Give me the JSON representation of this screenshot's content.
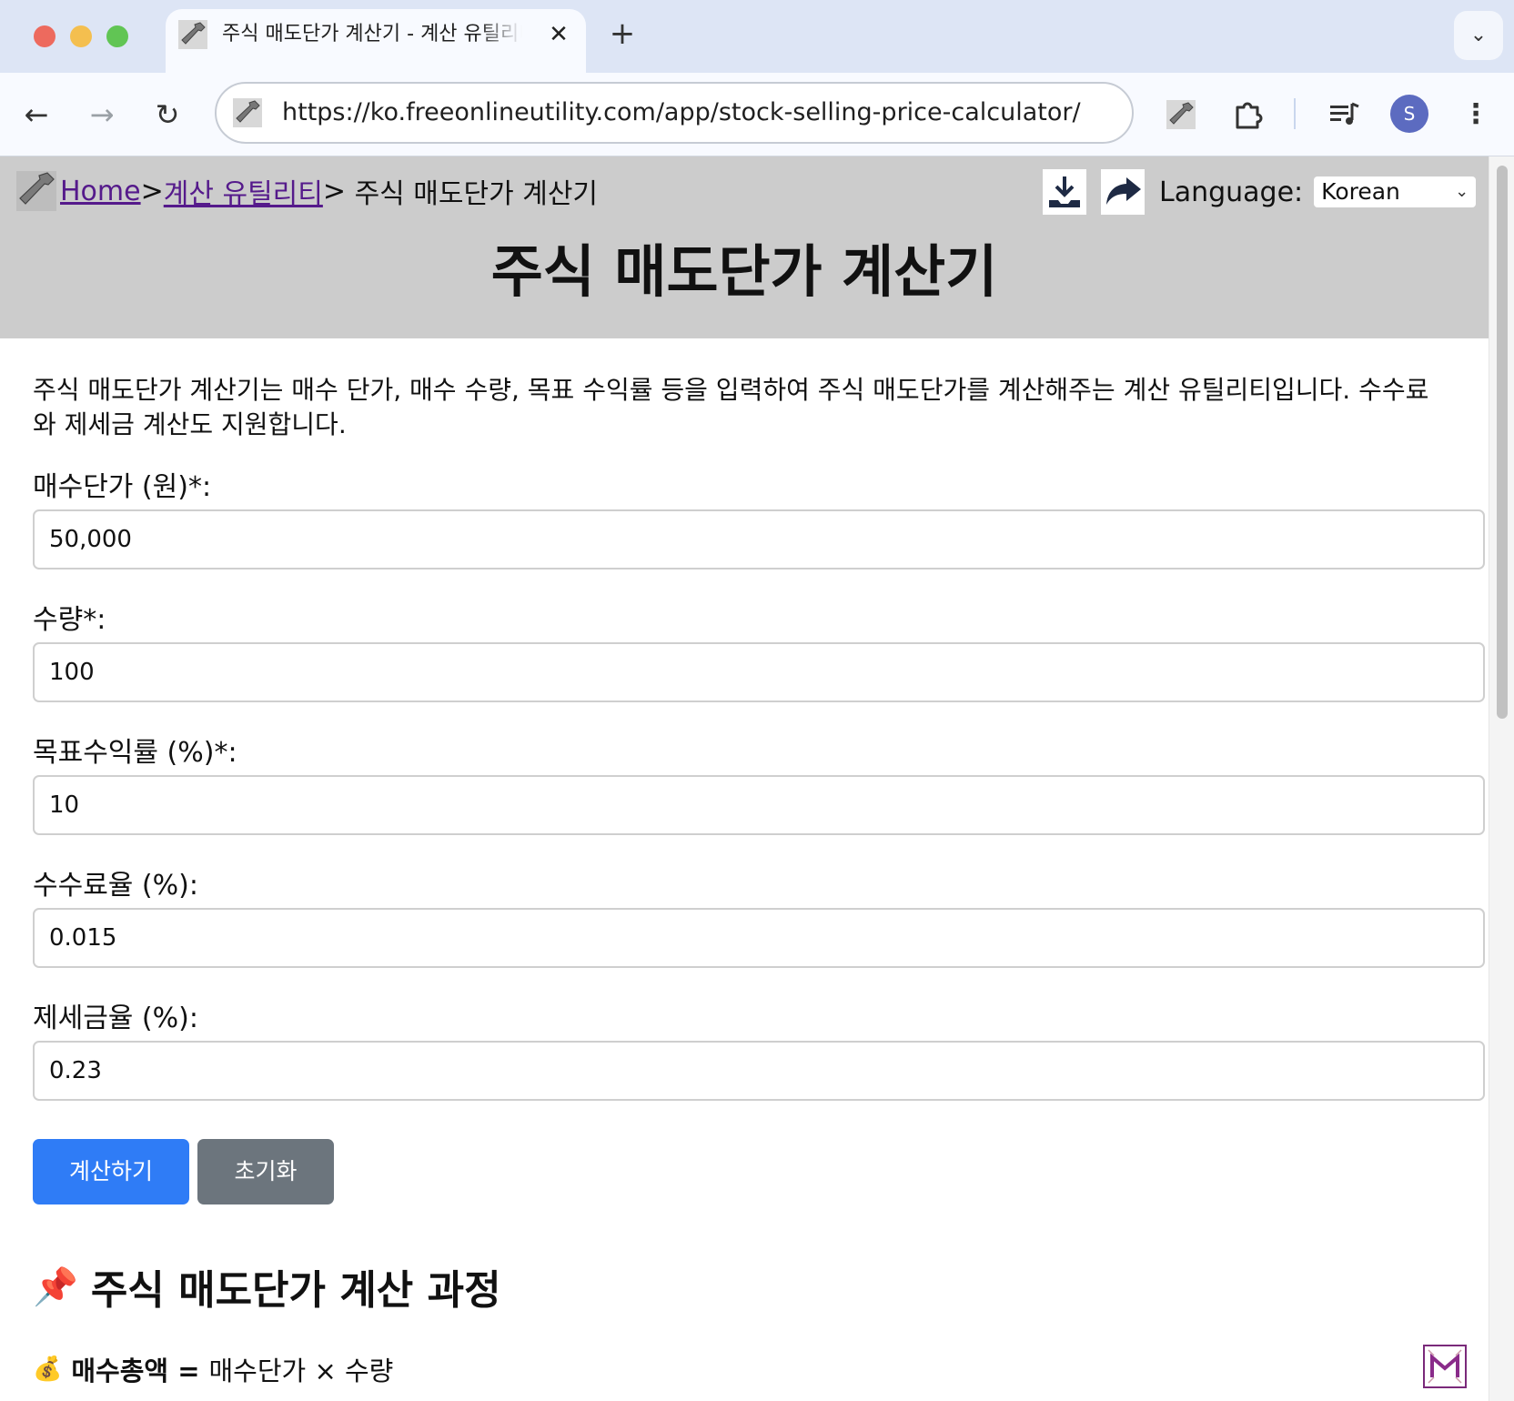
{
  "browser": {
    "tab_title": "주식 매도단가 계산기 - 계산 유틸리티",
    "tab_close": "✕",
    "new_tab": "+",
    "url": "https://ko.freeonlineutility.com/app/stock-selling-price-calculator/",
    "profile_initial": "S",
    "icons": [
      "back-icon",
      "forward-icon",
      "reload-icon",
      "extensions-icon",
      "media-icon",
      "more-icon"
    ]
  },
  "header": {
    "breadcrumb": {
      "home": "Home",
      "sep1": ">",
      "category": "계산 유틸리티",
      "sep2": "> ",
      "current": "주식 매도단가 계산기"
    },
    "language_label": "Language:",
    "language_value": "Korean",
    "title": "주식 매도단가 계산기"
  },
  "intro": "주식 매도단가 계산기는 매수 단가, 매수 수량, 목표 수익률 등을 입력하여 주식 매도단가를 계산해주는 계산 유틸리티입니다. 수수료와 제세금 계산도 지원합니다.",
  "form": {
    "fields": [
      {
        "label": "매수단가 (원)*:",
        "value": "50,000"
      },
      {
        "label": "수량*:",
        "value": "100"
      },
      {
        "label": "목표수익률 (%)*:",
        "value": "10"
      },
      {
        "label": "수수료율 (%):",
        "value": "0.015"
      },
      {
        "label": "제세금율 (%):",
        "value": "0.23"
      }
    ],
    "calculate_label": "계산하기",
    "reset_label": "초기화"
  },
  "process": {
    "title_emoji": "📌",
    "title": "주식 매도단가 계산 과정",
    "formula_emoji": "💰",
    "formula_term": "매수총액 =",
    "formula_expr": "매수단가 × 수량"
  },
  "colors": {
    "header_bg": "#cccccc",
    "calculate_button": "#2f7cf6",
    "reset_button": "#6c757d",
    "link": "#551a8b"
  }
}
